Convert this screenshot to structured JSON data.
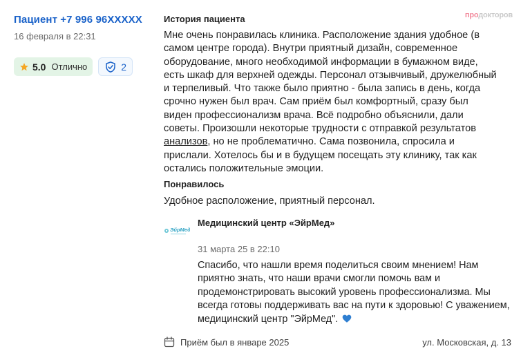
{
  "patient": {
    "name": "Пациент +7 996 96XXXXX",
    "date": "16 февраля в 22:31",
    "rating": "5.0",
    "rating_word": "Отлично",
    "visits": "2"
  },
  "review": {
    "title": "История пациента",
    "brand_part1": "про",
    "brand_part2": "докторов",
    "text_before_link": "Мне очень понравилась клиника. Расположение здания удобное (в самом центре города). Внутри приятный дизайн, современное оборудование, много необходимой информации в бумажном виде, есть шкаф для верхней одежды. Персонал отзывчивый, дружелюбный и терпеливый. Что также было приятно - была запись в день, когда срочно нужен был врач. Сам приём был комфортный, сразу был виден профессионализм врача. Всё подробно объяснили, дали советы. Произошли некоторые трудности с отправкой результатов ",
    "link_text": "анализов",
    "text_after_link": ", но не проблематично. Сама позвонила, спросила и прислали. Хотелось бы и в будущем посещать эту клинику, так как остались положительные эмоции.",
    "liked_title": "Понравилось",
    "liked_text": "Удобное расположение, приятный персонал."
  },
  "reply": {
    "clinic_name": "Медицинский центр «ЭйрМед»",
    "logo_text": "ЭйрМед",
    "date": "31 марта 25 в 22:10",
    "text": "Спасибо, что нашли время поделиться своим мнением! Нам приятно знать, что наши врачи смогли помочь вам и продемонстрировать высокий уровень профессионализма. Мы всегда готовы поддерживать вас на пути к здоровью! С уважением, медицинский центр \"ЭйрМед\"."
  },
  "footer": {
    "visit_date": "Приём был в январе 2025",
    "address": "ул. Московская, д. 13"
  },
  "colors": {
    "link_blue": "#1a62c9",
    "rating_bg": "#e3f4e6",
    "star": "#f5a623",
    "heart": "#2f7fd1",
    "brand_pink": "#f28b9d"
  },
  "icons": [
    "star-icon",
    "shield-check-icon",
    "heart-icon",
    "calendar-icon",
    "clinic-logo"
  ]
}
